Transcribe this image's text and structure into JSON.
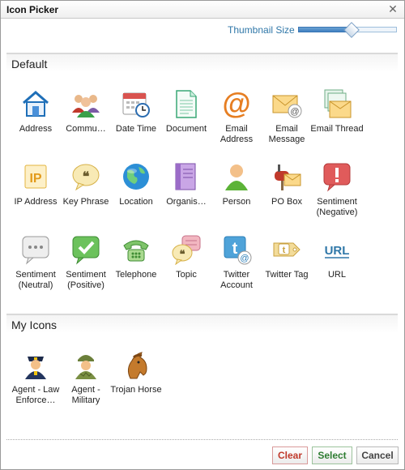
{
  "window": {
    "title": "Icon Picker"
  },
  "thumbnail": {
    "label": "Thumbnail Size",
    "level": 0.54
  },
  "sections": {
    "default": {
      "title": "Default",
      "icons": [
        {
          "label": "Address",
          "icon": "house-icon"
        },
        {
          "label": "Commu…",
          "icon": "community-icon"
        },
        {
          "label": "Date Time",
          "icon": "calendar-clock-icon"
        },
        {
          "label": "Document",
          "icon": "document-icon"
        },
        {
          "label": "Email Address",
          "icon": "at-sign-icon"
        },
        {
          "label": "Email Message",
          "icon": "envelope-icon"
        },
        {
          "label": "Email Thread",
          "icon": "email-thread-icon"
        },
        {
          "label": "IP Address",
          "icon": "ip-icon"
        },
        {
          "label": "Key Phrase",
          "icon": "quote-bubble-icon"
        },
        {
          "label": "Location",
          "icon": "globe-icon"
        },
        {
          "label": "Organis…",
          "icon": "binder-icon"
        },
        {
          "label": "Person",
          "icon": "person-icon"
        },
        {
          "label": "PO Box",
          "icon": "mailbox-icon"
        },
        {
          "label": "Sentiment (Negative)",
          "icon": "exclamation-bubble-icon"
        },
        {
          "label": "Sentiment (Neutral)",
          "icon": "ellipsis-bubble-icon"
        },
        {
          "label": "Sentiment (Positive)",
          "icon": "check-bubble-icon"
        },
        {
          "label": "Telephone",
          "icon": "telephone-icon"
        },
        {
          "label": "Topic",
          "icon": "topic-bubbles-icon"
        },
        {
          "label": "Twitter Account",
          "icon": "twitter-account-icon"
        },
        {
          "label": "Twitter Tag",
          "icon": "twitter-tag-icon"
        },
        {
          "label": "URL",
          "icon": "url-icon"
        }
      ]
    },
    "mine": {
      "title": "My Icons",
      "icons": [
        {
          "label": "Agent - Law Enforce…",
          "icon": "police-officer-icon"
        },
        {
          "label": "Agent - Military",
          "icon": "soldier-icon"
        },
        {
          "label": "Trojan Horse",
          "icon": "trojan-horse-icon"
        }
      ]
    }
  },
  "buttons": {
    "clear": "Clear",
    "select": "Select",
    "cancel": "Cancel"
  },
  "colors": {
    "accent": "#2f77a8",
    "clear": "#c0392b",
    "select": "#2e7d32"
  }
}
